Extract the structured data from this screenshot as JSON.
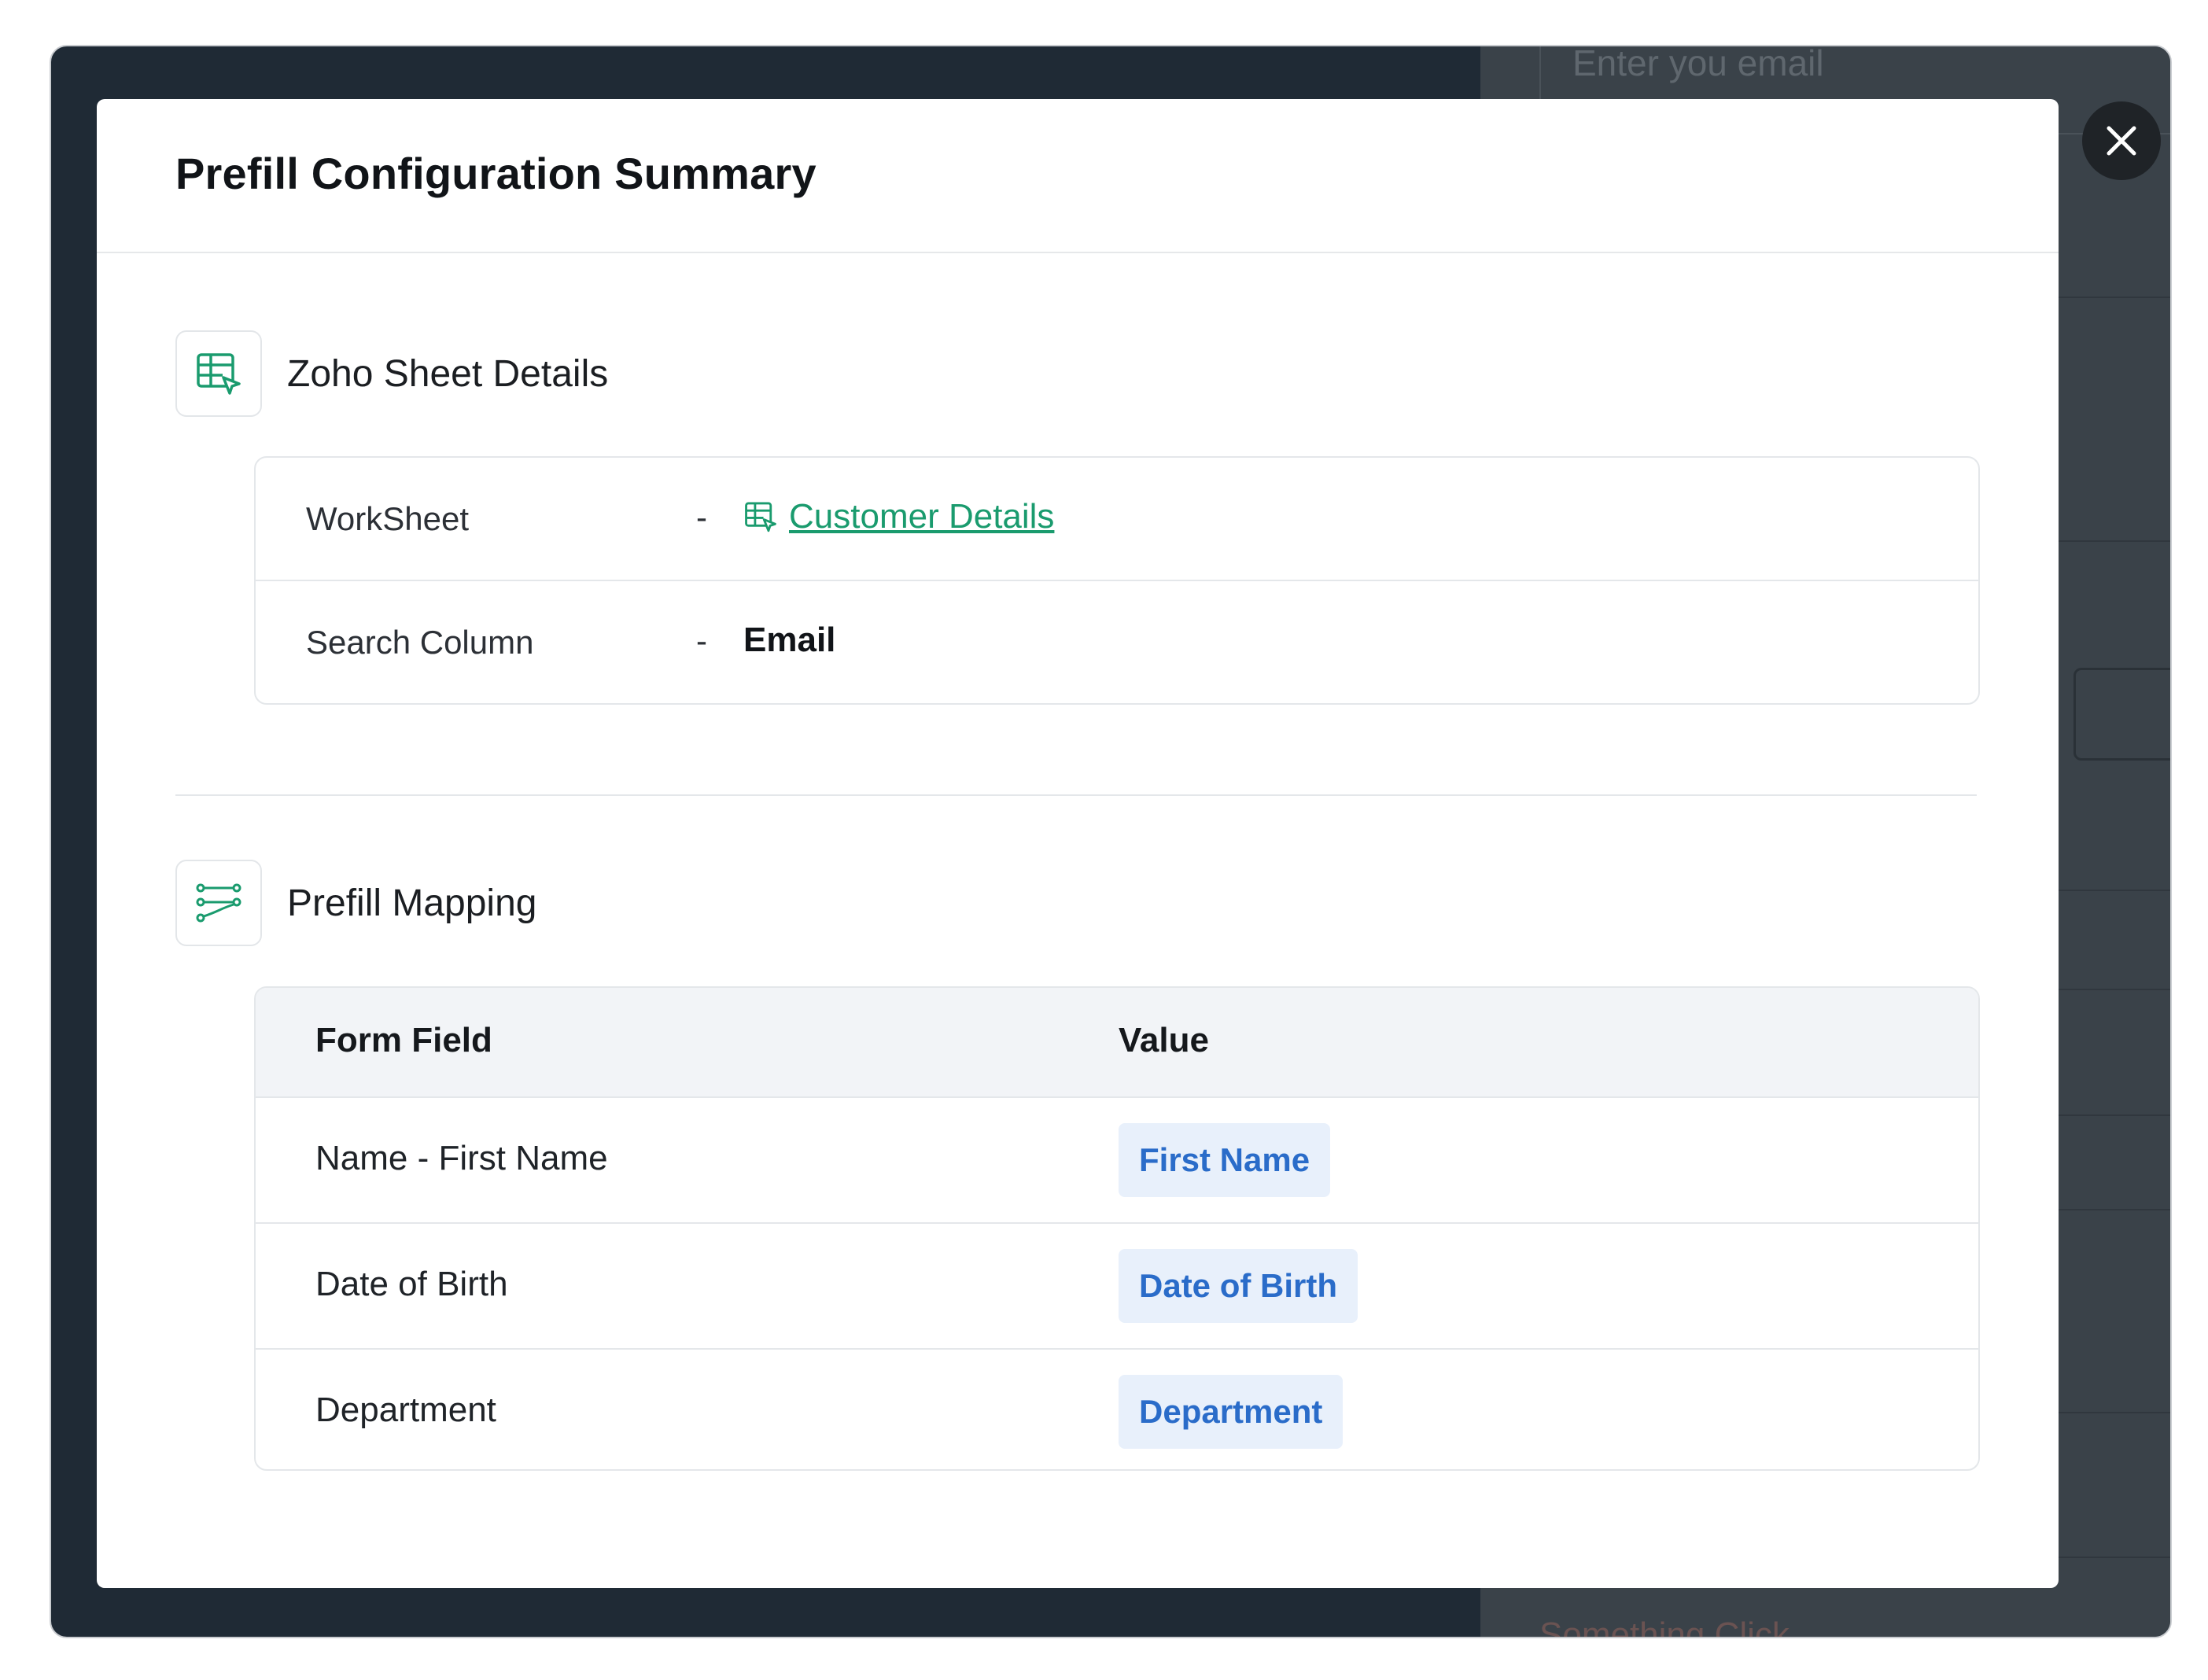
{
  "background": {
    "input_placeholder": "Enter you email",
    "bottom_text": "Something Click"
  },
  "modal": {
    "title": "Prefill Configuration Summary",
    "close_icon": "close-icon"
  },
  "sheet_details": {
    "title": "Zoho Sheet Details",
    "icon": "sheet-icon",
    "rows": [
      {
        "label": "WorkSheet",
        "separator": "-",
        "value": "Customer Details",
        "icon": "sheet-icon"
      },
      {
        "label": "Search Column",
        "separator": "-",
        "value": "Email"
      }
    ]
  },
  "prefill_mapping": {
    "title": "Prefill Mapping",
    "icon": "mapping-icon",
    "columns": [
      "Form Field",
      "Value"
    ],
    "rows": [
      {
        "field": "Name - First Name",
        "value": "First Name"
      },
      {
        "field": "Date of Birth",
        "value": "Date of Birth"
      },
      {
        "field": "Department",
        "value": "Department"
      }
    ]
  },
  "colors": {
    "accent_green": "#1a9b6e",
    "chip_blue": "#2a6cc9",
    "chip_bg": "#e8f0fb",
    "overlay": "#1f2a35"
  }
}
